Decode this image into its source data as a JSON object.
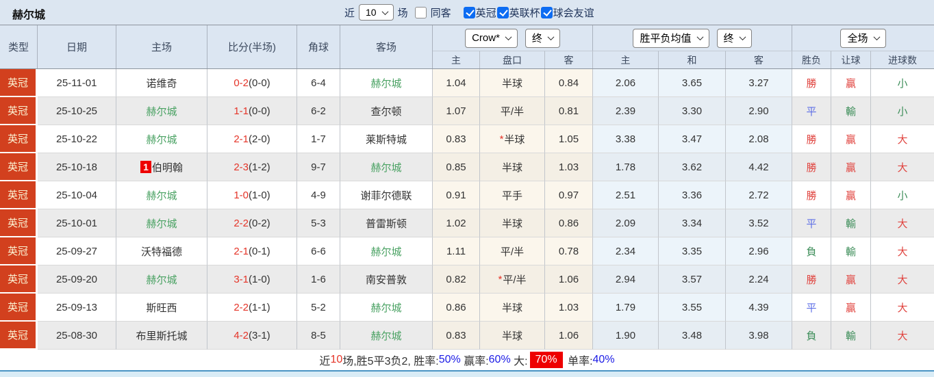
{
  "topbar": {
    "title": "赫尔城",
    "recent_label": "近",
    "recent_value": "10",
    "matches_label": "场",
    "same_opponent_label": "同客",
    "same_opponent_checked": false,
    "filters": [
      {
        "label": "英冠",
        "checked": true
      },
      {
        "label": "英联杯",
        "checked": true
      },
      {
        "label": "球会友谊",
        "checked": true
      }
    ]
  },
  "header": {
    "main_columns": [
      "类型",
      "日期",
      "主场",
      "比分(半场)",
      "角球",
      "客场"
    ],
    "handicap_select": "Crow*",
    "handicap_time_select": "终",
    "odds_select": "胜平负均值",
    "odds_time_select": "终",
    "result_select": "全场",
    "sub_columns": [
      "主",
      "盘口",
      "客",
      "主",
      "和",
      "客",
      "胜负",
      "让球",
      "进球数"
    ]
  },
  "rows": [
    {
      "league": "英冠",
      "date": "25-11-01",
      "home": {
        "name": "诺维奇",
        "self": false,
        "badge": ""
      },
      "score": "0-2",
      "half": "(0-0)",
      "corners": "6-4",
      "away": {
        "name": "赫尔城",
        "self": true
      },
      "ah": {
        "home": "1.04",
        "line": "半球",
        "star": false,
        "away": "0.84"
      },
      "eu": {
        "home": "2.06",
        "draw": "3.65",
        "away": "3.27"
      },
      "res": {
        "wdl": {
          "t": "勝",
          "tone": "red"
        },
        "hcp": {
          "t": "贏",
          "tone": "red"
        },
        "goals": {
          "t": "小",
          "tone": "green"
        }
      }
    },
    {
      "league": "英冠",
      "date": "25-10-25",
      "home": {
        "name": "赫尔城",
        "self": true,
        "badge": ""
      },
      "score": "1-1",
      "half": "(0-0)",
      "corners": "6-2",
      "away": {
        "name": "查尔顿",
        "self": false
      },
      "ah": {
        "home": "1.07",
        "line": "平/半",
        "star": false,
        "away": "0.81"
      },
      "eu": {
        "home": "2.39",
        "draw": "3.30",
        "away": "2.90"
      },
      "res": {
        "wdl": {
          "t": "平",
          "tone": "blue"
        },
        "hcp": {
          "t": "輸",
          "tone": "green"
        },
        "goals": {
          "t": "小",
          "tone": "green"
        }
      }
    },
    {
      "league": "英冠",
      "date": "25-10-22",
      "home": {
        "name": "赫尔城",
        "self": true,
        "badge": ""
      },
      "score": "2-1",
      "half": "(2-0)",
      "corners": "1-7",
      "away": {
        "name": "莱斯特城",
        "self": false
      },
      "ah": {
        "home": "0.83",
        "line": "半球",
        "star": true,
        "away": "1.05"
      },
      "eu": {
        "home": "3.38",
        "draw": "3.47",
        "away": "2.08"
      },
      "res": {
        "wdl": {
          "t": "勝",
          "tone": "red"
        },
        "hcp": {
          "t": "贏",
          "tone": "red"
        },
        "goals": {
          "t": "大",
          "tone": "red"
        }
      }
    },
    {
      "league": "英冠",
      "date": "25-10-18",
      "home": {
        "name": "伯明翰",
        "self": false,
        "badge": "1"
      },
      "score": "2-3",
      "half": "(1-2)",
      "corners": "9-7",
      "away": {
        "name": "赫尔城",
        "self": true
      },
      "ah": {
        "home": "0.85",
        "line": "半球",
        "star": false,
        "away": "1.03"
      },
      "eu": {
        "home": "1.78",
        "draw": "3.62",
        "away": "4.42"
      },
      "res": {
        "wdl": {
          "t": "勝",
          "tone": "red"
        },
        "hcp": {
          "t": "贏",
          "tone": "red"
        },
        "goals": {
          "t": "大",
          "tone": "red"
        }
      }
    },
    {
      "league": "英冠",
      "date": "25-10-04",
      "home": {
        "name": "赫尔城",
        "self": true,
        "badge": ""
      },
      "score": "1-0",
      "half": "(1-0)",
      "corners": "4-9",
      "away": {
        "name": "谢菲尔德联",
        "self": false
      },
      "ah": {
        "home": "0.91",
        "line": "平手",
        "star": false,
        "away": "0.97"
      },
      "eu": {
        "home": "2.51",
        "draw": "3.36",
        "away": "2.72"
      },
      "res": {
        "wdl": {
          "t": "勝",
          "tone": "red"
        },
        "hcp": {
          "t": "贏",
          "tone": "red"
        },
        "goals": {
          "t": "小",
          "tone": "green"
        }
      }
    },
    {
      "league": "英冠",
      "date": "25-10-01",
      "home": {
        "name": "赫尔城",
        "self": true,
        "badge": ""
      },
      "score": "2-2",
      "half": "(0-2)",
      "corners": "5-3",
      "away": {
        "name": "普雷斯顿",
        "self": false
      },
      "ah": {
        "home": "1.02",
        "line": "半球",
        "star": false,
        "away": "0.86"
      },
      "eu": {
        "home": "2.09",
        "draw": "3.34",
        "away": "3.52"
      },
      "res": {
        "wdl": {
          "t": "平",
          "tone": "blue"
        },
        "hcp": {
          "t": "輸",
          "tone": "green"
        },
        "goals": {
          "t": "大",
          "tone": "red"
        }
      }
    },
    {
      "league": "英冠",
      "date": "25-09-27",
      "home": {
        "name": "沃特福德",
        "self": false,
        "badge": ""
      },
      "score": "2-1",
      "half": "(0-1)",
      "corners": "6-6",
      "away": {
        "name": "赫尔城",
        "self": true
      },
      "ah": {
        "home": "1.11",
        "line": "平/半",
        "star": false,
        "away": "0.78"
      },
      "eu": {
        "home": "2.34",
        "draw": "3.35",
        "away": "2.96"
      },
      "res": {
        "wdl": {
          "t": "負",
          "tone": "green"
        },
        "hcp": {
          "t": "輸",
          "tone": "green"
        },
        "goals": {
          "t": "大",
          "tone": "red"
        }
      }
    },
    {
      "league": "英冠",
      "date": "25-09-20",
      "home": {
        "name": "赫尔城",
        "self": true,
        "badge": ""
      },
      "score": "3-1",
      "half": "(1-0)",
      "corners": "1-6",
      "away": {
        "name": "南安普敦",
        "self": false
      },
      "ah": {
        "home": "0.82",
        "line": "平/半",
        "star": true,
        "away": "1.06"
      },
      "eu": {
        "home": "2.94",
        "draw": "3.57",
        "away": "2.24"
      },
      "res": {
        "wdl": {
          "t": "勝",
          "tone": "red"
        },
        "hcp": {
          "t": "贏",
          "tone": "red"
        },
        "goals": {
          "t": "大",
          "tone": "red"
        }
      }
    },
    {
      "league": "英冠",
      "date": "25-09-13",
      "home": {
        "name": "斯旺西",
        "self": false,
        "badge": ""
      },
      "score": "2-2",
      "half": "(1-1)",
      "corners": "5-2",
      "away": {
        "name": "赫尔城",
        "self": true
      },
      "ah": {
        "home": "0.86",
        "line": "半球",
        "star": false,
        "away": "1.03"
      },
      "eu": {
        "home": "1.79",
        "draw": "3.55",
        "away": "4.39"
      },
      "res": {
        "wdl": {
          "t": "平",
          "tone": "blue"
        },
        "hcp": {
          "t": "贏",
          "tone": "red"
        },
        "goals": {
          "t": "大",
          "tone": "red"
        }
      }
    },
    {
      "league": "英冠",
      "date": "25-08-30",
      "home": {
        "name": "布里斯托城",
        "self": false,
        "badge": ""
      },
      "score": "4-2",
      "half": "(3-1)",
      "corners": "8-5",
      "away": {
        "name": "赫尔城",
        "self": true
      },
      "ah": {
        "home": "0.83",
        "line": "半球",
        "star": false,
        "away": "1.06"
      },
      "eu": {
        "home": "1.90",
        "draw": "3.48",
        "away": "3.98"
      },
      "res": {
        "wdl": {
          "t": "負",
          "tone": "green"
        },
        "hcp": {
          "t": "輸",
          "tone": "green"
        },
        "goals": {
          "t": "大",
          "tone": "red"
        }
      }
    }
  ],
  "summary": {
    "segments": [
      {
        "text": "近",
        "style": "dark"
      },
      {
        "text": "10",
        "style": "red"
      },
      {
        "text": "场,胜5平3负2, 胜率:",
        "style": "dark"
      },
      {
        "text": "50%",
        "style": "blue"
      },
      {
        "text": " 赢率:",
        "style": "dark"
      },
      {
        "text": "60%",
        "style": "blue"
      },
      {
        "text": " 大:",
        "style": "dark"
      },
      {
        "text": "70%",
        "style": "highlight"
      },
      {
        "text": " 单率:",
        "style": "dark"
      },
      {
        "text": "40%",
        "style": "blue"
      }
    ]
  },
  "colors": {
    "league_badge_bg": "#d2401e",
    "team_highlight_green": "#4aa263",
    "score_red": "#e53428",
    "win_red": "#e0433e",
    "draw_blue": "#5e6fe6",
    "lose_green": "#3e8e5a",
    "summary_link_blue": "#1a1ae6",
    "summary_highlight_bg": "#ee0000",
    "header_bg": "#dce6f2",
    "checkbox_blue": "#0d6cf2"
  }
}
